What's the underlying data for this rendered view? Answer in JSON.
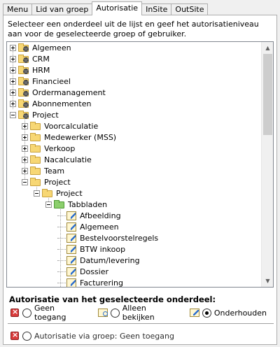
{
  "tabs": [
    {
      "label": "Menu",
      "active": false
    },
    {
      "label": "Lid van groep",
      "active": false
    },
    {
      "label": "Autorisatie",
      "active": true
    },
    {
      "label": "InSite",
      "active": false
    },
    {
      "label": "OutSite",
      "active": false
    }
  ],
  "instructions": "Selecteer een onderdeel uit de lijst en geef het autorisatieniveau aan voor de geselecteerde groep of gebruiker.",
  "tree": {
    "items": [
      {
        "label": "Algemeen",
        "icon": "gear-folder-icon",
        "expander": "plus"
      },
      {
        "label": "CRM",
        "icon": "gear-folder-icon",
        "expander": "plus"
      },
      {
        "label": "HRM",
        "icon": "gear-folder-icon",
        "expander": "plus"
      },
      {
        "label": "Financieel",
        "icon": "gear-folder-icon",
        "expander": "plus"
      },
      {
        "label": "Ordermanagement",
        "icon": "gear-folder-icon",
        "expander": "plus"
      },
      {
        "label": "Abonnementen",
        "icon": "gear-folder-icon",
        "expander": "plus"
      },
      {
        "label": "Project",
        "icon": "gear-folder-icon",
        "expander": "minus"
      },
      {
        "label": "Voorcalculatie",
        "icon": "folder-icon",
        "expander": "plus"
      },
      {
        "label": "Medewerker (MSS)",
        "icon": "folder-icon",
        "expander": "plus"
      },
      {
        "label": "Verkoop",
        "icon": "folder-icon",
        "expander": "plus"
      },
      {
        "label": "Nacalculatie",
        "icon": "folder-icon",
        "expander": "plus"
      },
      {
        "label": "Team",
        "icon": "folder-icon",
        "expander": "plus"
      },
      {
        "label": "Project",
        "icon": "folder-icon",
        "expander": "minus"
      },
      {
        "label": "Project",
        "icon": "folder-icon",
        "expander": "minus"
      },
      {
        "label": "Tabbladen",
        "icon": "green-folder-icon",
        "expander": "minus"
      },
      {
        "label": "Afbeelding",
        "icon": "edit-page-icon",
        "expander": "none"
      },
      {
        "label": "Algemeen",
        "icon": "edit-page-icon",
        "expander": "none"
      },
      {
        "label": "Bestelvoorstelregels",
        "icon": "edit-page-icon",
        "expander": "none"
      },
      {
        "label": "BTW inkoop",
        "icon": "edit-page-icon",
        "expander": "none"
      },
      {
        "label": "Datum/levering",
        "icon": "edit-page-icon",
        "expander": "none"
      },
      {
        "label": "Dossier",
        "icon": "edit-page-icon",
        "expander": "none"
      },
      {
        "label": "Facturering",
        "icon": "edit-page-icon",
        "expander": "none"
      }
    ]
  },
  "authorization": {
    "title": "Autorisatie van het geselecteerde onderdeel:",
    "options": [
      {
        "label": "Geen toegang",
        "icon": "no-access-icon",
        "selected": false
      },
      {
        "label": "Alleen bekijken",
        "icon": "view-only-icon",
        "selected": false
      },
      {
        "label": "Onderhouden",
        "icon": "edit-icon",
        "selected": true
      }
    ],
    "via_group": {
      "label": "Autorisatie via groep: Geen toegang",
      "icon": "no-access-icon",
      "selected": false
    }
  }
}
